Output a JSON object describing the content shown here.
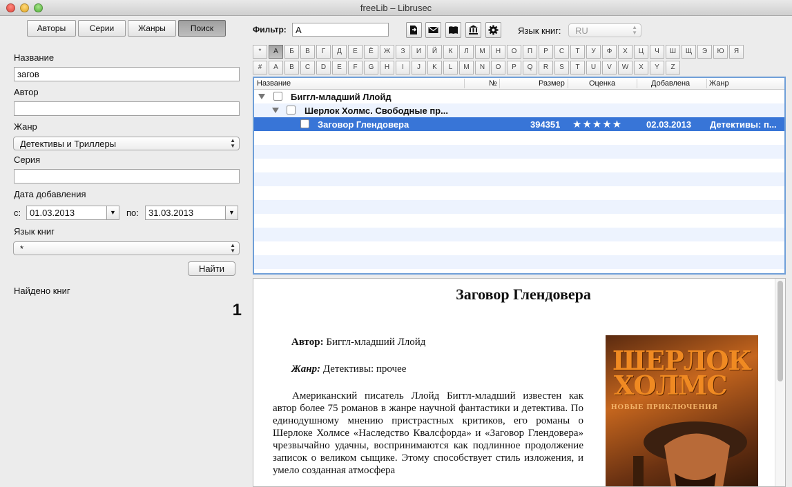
{
  "window": {
    "title": "freeLib – Librusec"
  },
  "left": {
    "tabs": [
      "Авторы",
      "Серии",
      "Жанры",
      "Поиск"
    ],
    "active_tab": "Поиск",
    "title_label": "Название",
    "title_value": "загов",
    "author_label": "Автор",
    "author_value": "",
    "genre_label": "Жанр",
    "genre_value": "Детективы и Триллеры",
    "series_label": "Серия",
    "series_value": "",
    "date_label": "Дата добавления",
    "from_label": "с:",
    "from_value": "01.03.2013",
    "to_label": "по:",
    "to_value": "31.03.2013",
    "lang_label": "Язык книг",
    "lang_value": "*",
    "find_button": "Найти",
    "found_label": "Найдено книг",
    "found_count": "1"
  },
  "toolbar": {
    "filter_label": "Фильтр:",
    "filter_value": "А",
    "icons": [
      "export-icon",
      "mail-icon",
      "book-icon",
      "library-icon",
      "gear-icon"
    ],
    "lang_label": "Язык книг:",
    "lang_value": "RU"
  },
  "alphabet": {
    "row1": [
      "*",
      "А",
      "Б",
      "В",
      "Г",
      "Д",
      "Е",
      "Ё",
      "Ж",
      "З",
      "И",
      "Й",
      "К",
      "Л",
      "М",
      "Н",
      "О",
      "П",
      "Р",
      "С",
      "Т",
      "У",
      "Ф",
      "Х",
      "Ц",
      "Ч",
      "Ш",
      "Щ",
      "Э",
      "Ю",
      "Я"
    ],
    "row2": [
      "#",
      "A",
      "B",
      "C",
      "D",
      "E",
      "F",
      "G",
      "H",
      "I",
      "J",
      "K",
      "L",
      "M",
      "N",
      "O",
      "P",
      "Q",
      "R",
      "S",
      "T",
      "U",
      "V",
      "W",
      "X",
      "Y",
      "Z"
    ],
    "active": "А"
  },
  "tree": {
    "columns": {
      "name": "Название",
      "num": "№",
      "size": "Размер",
      "rating": "Оценка",
      "added": "Добавлена",
      "genre": "Жанр"
    },
    "author_row": "Биггл-младший Ллойд",
    "series_row": "Шерлок Холмс. Свободные пр...",
    "book": {
      "title": "Заговор Глендовера",
      "size": "394351",
      "stars": "★★★★★",
      "rating": 5,
      "added": "02.03.2013",
      "genre": "Детективы: п..."
    }
  },
  "annotation": {
    "title": "Заговор Глендовера",
    "author_label": "Автор:",
    "author": "Биггл-младший Ллойд",
    "genre_label": "Жанр:",
    "genre": "Детективы: прочее",
    "text": "Американский писатель Ллойд Биггл-младший известен как автор более 75 романов в жанре научной фантастики и детектива. По единодушному мнению пристрастных критиков, его романы о Шерлоке Холмсе «Наследство Квалсфорда» и «Заговор Глендовера» чрезвычайно удачны, воспринимаются как подлинное продолжение записок о великом сыщике. Этому способствует стиль изложения, и умело созданная атмосфера",
    "cover": {
      "line1": "ШЕРЛОК",
      "line2": "ХОЛМС",
      "line3": "НОВЫЕ ПРИКЛЮЧЕНИЯ"
    }
  }
}
